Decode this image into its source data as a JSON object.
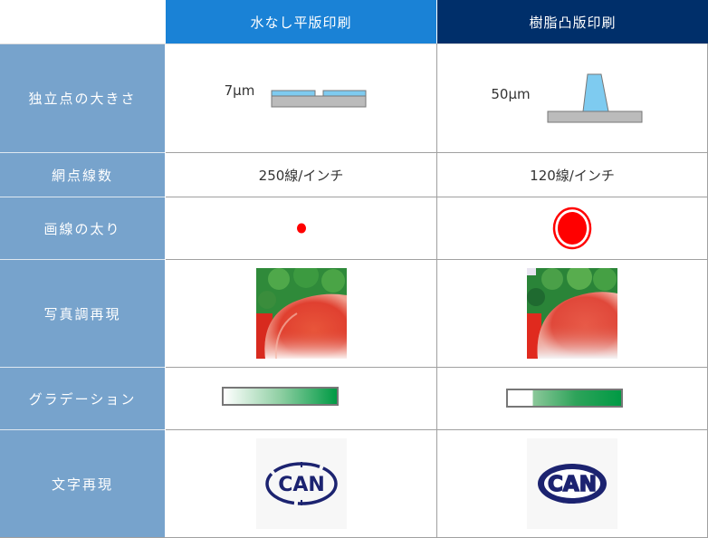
{
  "header": {
    "col1": "水なし平版印刷",
    "col2": "樹脂凸版印刷",
    "col1_color": "#1a82d6",
    "col2_color": "#002f6a"
  },
  "rows": [
    {
      "label": "独立点の大きさ",
      "col1": "7μm",
      "col2": "50μm"
    },
    {
      "label": "網点線数",
      "col1": "250線/インチ",
      "col2": "120線/インチ"
    },
    {
      "label": "画線の太り",
      "col1": "small-red-dot",
      "col2": "large-red-dot-with-ring"
    },
    {
      "label": "写真調再現",
      "col1": "photo-fine",
      "col2": "photo-coarse"
    },
    {
      "label": "グラデーション",
      "col1": "smooth-gradient",
      "col2": "stepped-gradient"
    },
    {
      "label": "文字再現",
      "col1": "CAN",
      "col2": "CAN"
    }
  ],
  "colors": {
    "label_bg": "#77a3cc",
    "dot_red": "#ff0000",
    "gradient_green": "#009a44",
    "logo_navy": "#1c2370"
  }
}
